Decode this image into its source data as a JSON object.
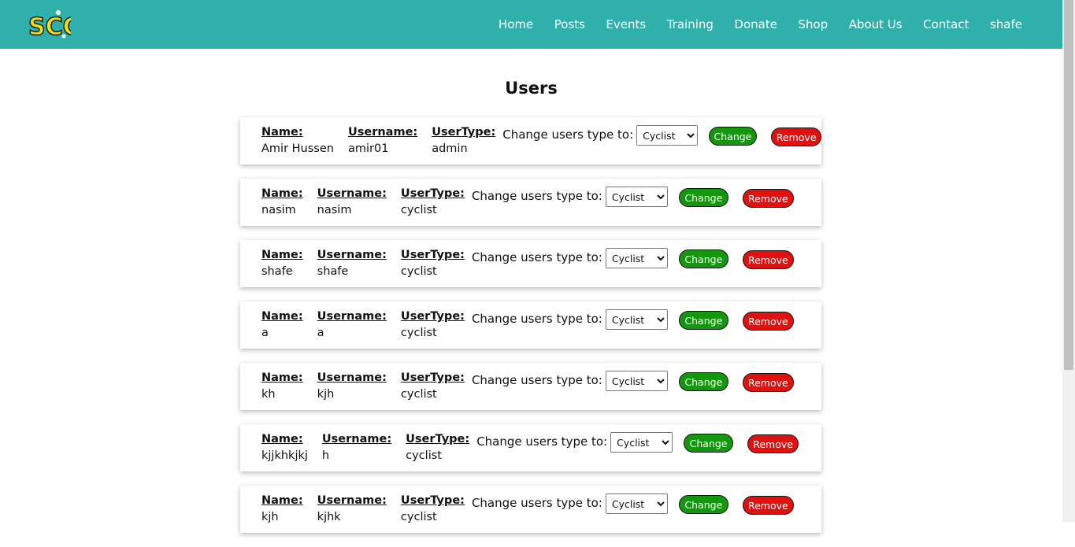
{
  "nav": {
    "logo_text": "SCC",
    "items": [
      "Home",
      "Posts",
      "Events",
      "Training",
      "Donate",
      "Shop",
      "About Us",
      "Contact",
      "shafe"
    ]
  },
  "page_title": "Users",
  "labels": {
    "name": "Name:",
    "username": "Username:",
    "usertype": "UserType:",
    "change_prompt": "Change users type to:",
    "change_button": "Change",
    "remove_button": "Remove"
  },
  "users": [
    {
      "name": "Amir Hussen",
      "username": "amir01",
      "usertype": "admin",
      "select_value": "Cyclist"
    },
    {
      "name": "nasim",
      "username": "nasim",
      "usertype": "cyclist",
      "select_value": "Cyclist"
    },
    {
      "name": "shafe",
      "username": "shafe",
      "usertype": "cyclist",
      "select_value": "Cyclist"
    },
    {
      "name": "a",
      "username": "a",
      "usertype": "cyclist",
      "select_value": "Cyclist"
    },
    {
      "name": "kh",
      "username": "kjh",
      "usertype": "cyclist",
      "select_value": "Cyclist"
    },
    {
      "name": "kjjkhkjkj",
      "username": "h",
      "usertype": "cyclist",
      "select_value": "Cyclist"
    },
    {
      "name": "kjh",
      "username": "kjhk",
      "usertype": "cyclist",
      "select_value": "Cyclist"
    }
  ],
  "colors": {
    "navbar": "#2fb0ab",
    "change_button": "#14960f",
    "remove_button": "#e31010",
    "logo_yellow": "#f2e20a"
  }
}
